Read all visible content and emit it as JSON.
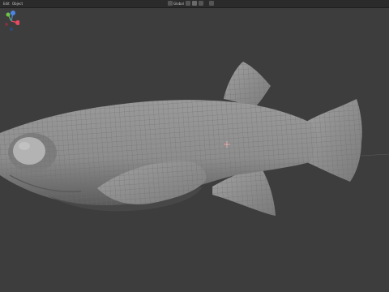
{
  "header": {
    "menu": [
      "Edit",
      "Object"
    ],
    "transform_mode": "Global"
  },
  "icons": {
    "orientation": "orientation-icon",
    "pivot": "pivot-icon",
    "snap": "snap-icon",
    "proportional": "proportional-editing-icon",
    "overlays": "overlays-icon"
  },
  "viewport": {
    "background": "#3d3d3d",
    "mesh_color": "#8a8a8a",
    "wire_color": "#6e6e6e",
    "axis_x_color": "#e84a5f",
    "axis_y_color": "#6fc24b",
    "axis_z_color": "#4a86e8"
  }
}
